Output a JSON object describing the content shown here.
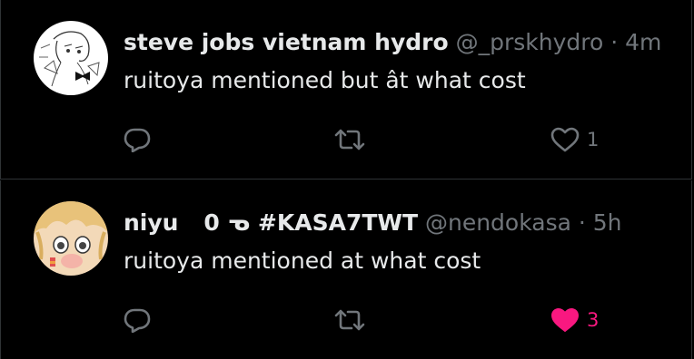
{
  "colors": {
    "background": "#000000",
    "text_primary": "#e7e9ea",
    "text_secondary": "#71767b",
    "border": "#2f3336",
    "like_active": "#f91880"
  },
  "tweets": [
    {
      "display_name": "steve jobs vietnam hydro",
      "handle": "@_prskhydro",
      "separator": "·",
      "time": "4m",
      "text": "ruitoya mentioned but ât what cost",
      "avatar_icon": "anime-sketch-avatar-icon",
      "actions": {
        "reply_icon": "reply-icon",
        "retweet_icon": "retweet-icon",
        "like_icon": "heart-outline-icon",
        "like_count": "1",
        "liked": false
      }
    },
    {
      "display_name": "niyu",
      "name_emoji": "0 ᓀ #KASA7TWT",
      "handle": "@nendokasa",
      "separator": "·",
      "time": "5h",
      "text": "ruitoya mentioned at what cost",
      "avatar_icon": "blonde-anime-avatar-icon",
      "actions": {
        "reply_icon": "reply-icon",
        "retweet_icon": "retweet-icon",
        "like_icon": "heart-filled-icon",
        "like_count": "3",
        "liked": true
      }
    }
  ]
}
